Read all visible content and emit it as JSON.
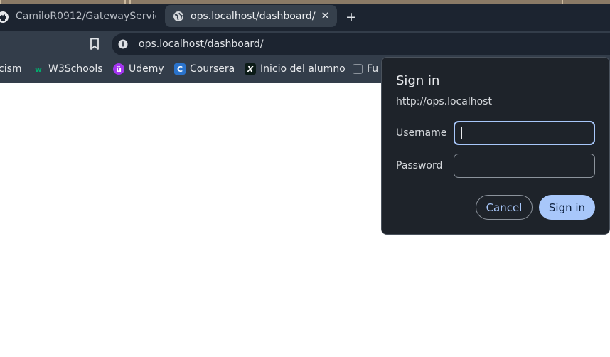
{
  "tabs": {
    "inactive": {
      "label": "CamiloR0912/GatewayServic",
      "icon": "github-icon"
    },
    "active": {
      "label": "ops.localhost/dashboard/",
      "icon": "globe-icon",
      "close_glyph": "✕"
    },
    "new_tab_glyph": "+"
  },
  "omnibox": {
    "url": "ops.localhost/dashboard/"
  },
  "bookmarks": [
    {
      "label": "cism",
      "icon": "none"
    },
    {
      "label": "W3Schools",
      "icon": "w3schools-icon",
      "letter": "w"
    },
    {
      "label": "Udemy",
      "icon": "udemy-icon",
      "letter": "ü"
    },
    {
      "label": "Coursera",
      "icon": "coursera-icon",
      "letter": "C"
    },
    {
      "label": "Inicio del alumno",
      "icon": "x-icon",
      "letter": "X"
    },
    {
      "label": "Fu",
      "icon": "page-icon",
      "letter": ""
    }
  ],
  "dialog": {
    "title": "Sign in",
    "origin": "http://ops.localhost",
    "username_label": "Username",
    "username_value": "",
    "password_label": "Password",
    "password_value": "",
    "cancel_label": "Cancel",
    "signin_label": "Sign in"
  },
  "colors": {
    "tabbar": "#1c2430",
    "toolbar": "#333d4a",
    "dialog_bg": "#1e232a",
    "accent": "#a8c7fa"
  }
}
